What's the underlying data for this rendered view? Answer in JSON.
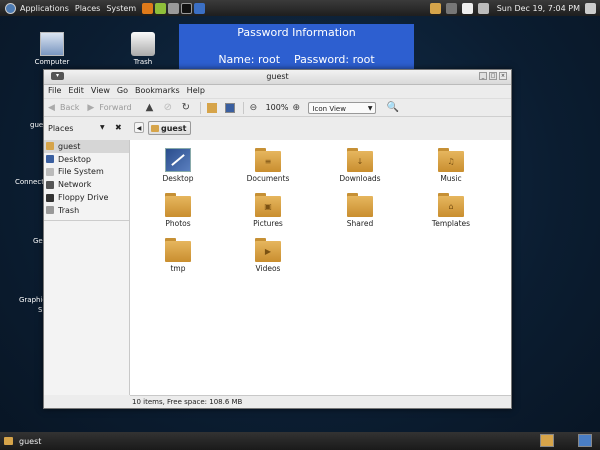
{
  "top_panel": {
    "menus": [
      "Applications",
      "Places",
      "System"
    ],
    "clock": "Sun Dec 19,  7:04 PM"
  },
  "desktop": {
    "icons": [
      {
        "label": "Computer"
      },
      {
        "label": "Trash"
      }
    ],
    "partial_labels": [
      "gue",
      "Connect",
      "Ge",
      "Graphic",
      "S"
    ]
  },
  "password_banner": {
    "title": "Password Information",
    "credentials": "Name: root    Password: root"
  },
  "window": {
    "title": "guest",
    "menu": [
      "File",
      "Edit",
      "View",
      "Go",
      "Bookmarks",
      "Help"
    ],
    "toolbar": {
      "back": "Back",
      "forward": "Forward",
      "zoom": "100%",
      "view_mode": "Icon View"
    },
    "places": {
      "label": "Places",
      "items": [
        "guest",
        "Desktop",
        "File System",
        "Network",
        "Floppy Drive",
        "Trash"
      ],
      "selected": "guest"
    },
    "path": {
      "current": "guest"
    },
    "files": [
      {
        "name": "Desktop",
        "icon": "desktop-icon"
      },
      {
        "name": "Documents",
        "icon": "document-folder-icon"
      },
      {
        "name": "Downloads",
        "icon": "download-folder-icon"
      },
      {
        "name": "Music",
        "icon": "music-folder-icon"
      },
      {
        "name": "Photos",
        "icon": "folder-icon"
      },
      {
        "name": "Pictures",
        "icon": "pictures-folder-icon"
      },
      {
        "name": "Shared",
        "icon": "folder-icon"
      },
      {
        "name": "Templates",
        "icon": "templates-folder-icon"
      },
      {
        "name": "tmp",
        "icon": "folder-icon"
      },
      {
        "name": "Videos",
        "icon": "video-folder-icon"
      }
    ],
    "status": "10 items, Free space: 108.6 MB"
  },
  "bottom_panel": {
    "task": "guest"
  },
  "colors": {
    "accent_banner": "#2d5fd0",
    "folder": "#d6a44a",
    "panel": "#2a2a2a"
  }
}
